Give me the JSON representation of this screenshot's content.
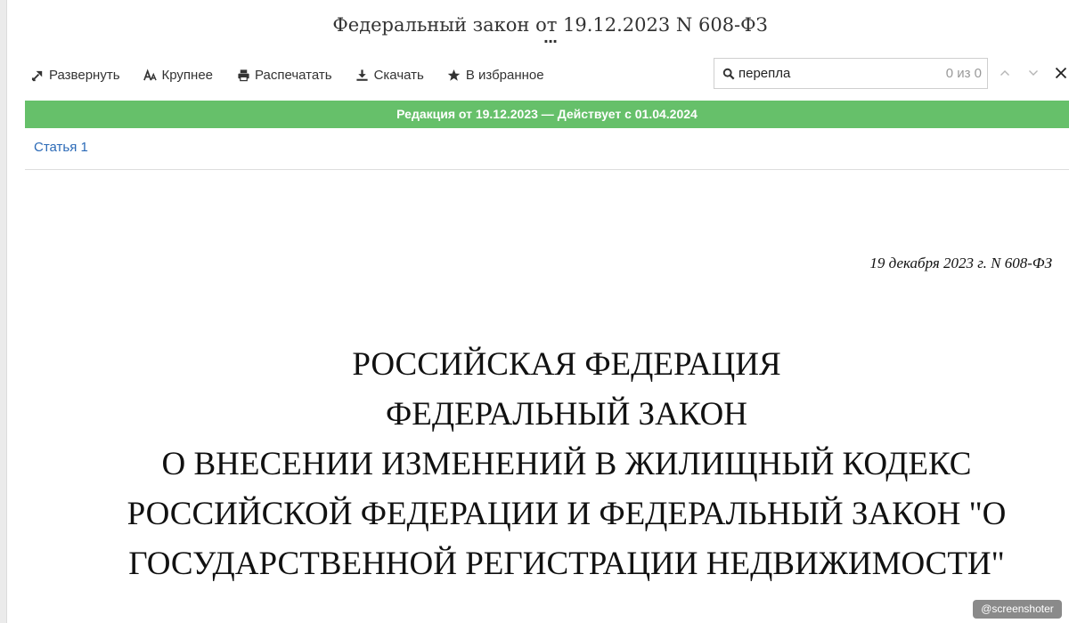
{
  "header": {
    "title": "Федеральный закон от 19.12.2023 N 608-ФЗ",
    "more": "..."
  },
  "toolbar": {
    "expand_label": "Развернуть",
    "expand_icon": "expand-arrow-icon",
    "larger_label": "Крупнее",
    "larger_icon": "font-size-icon",
    "print_label": "Распечатать",
    "print_icon": "printer-icon",
    "download_label": "Скачать",
    "download_icon": "download-icon",
    "favorite_label": "В избранное",
    "favorite_icon": "star-icon"
  },
  "search": {
    "value": "перепла",
    "count": "0 из 0",
    "icon": "search-icon"
  },
  "edition": {
    "text": "Редакция от 19.12.2023 — Действует с 01.04.2024",
    "color": "#66c06a"
  },
  "toc": {
    "link": "Статья 1",
    "color": "#2b6ab7"
  },
  "document": {
    "date": "19 декабря 2023 г. N 608-ФЗ",
    "heading_lines": [
      "РОССИЙСКАЯ ФЕДЕРАЦИЯ",
      "ФЕДЕРАЛЬНЫЙ ЗАКОН",
      "О ВНЕСЕНИИ ИЗМЕНЕНИЙ В ЖИЛИЩНЫЙ КОДЕКС",
      "РОССИЙСКОЙ ФЕДЕРАЦИИ И ФЕДЕРАЛЬНЫЙ ЗАКОН \"О",
      "ГОСУДАРСТВЕННОЙ РЕГИСТРАЦИИ НЕДВИЖИМОСТИ\""
    ]
  },
  "watermark": {
    "text": "@screenshoter"
  }
}
